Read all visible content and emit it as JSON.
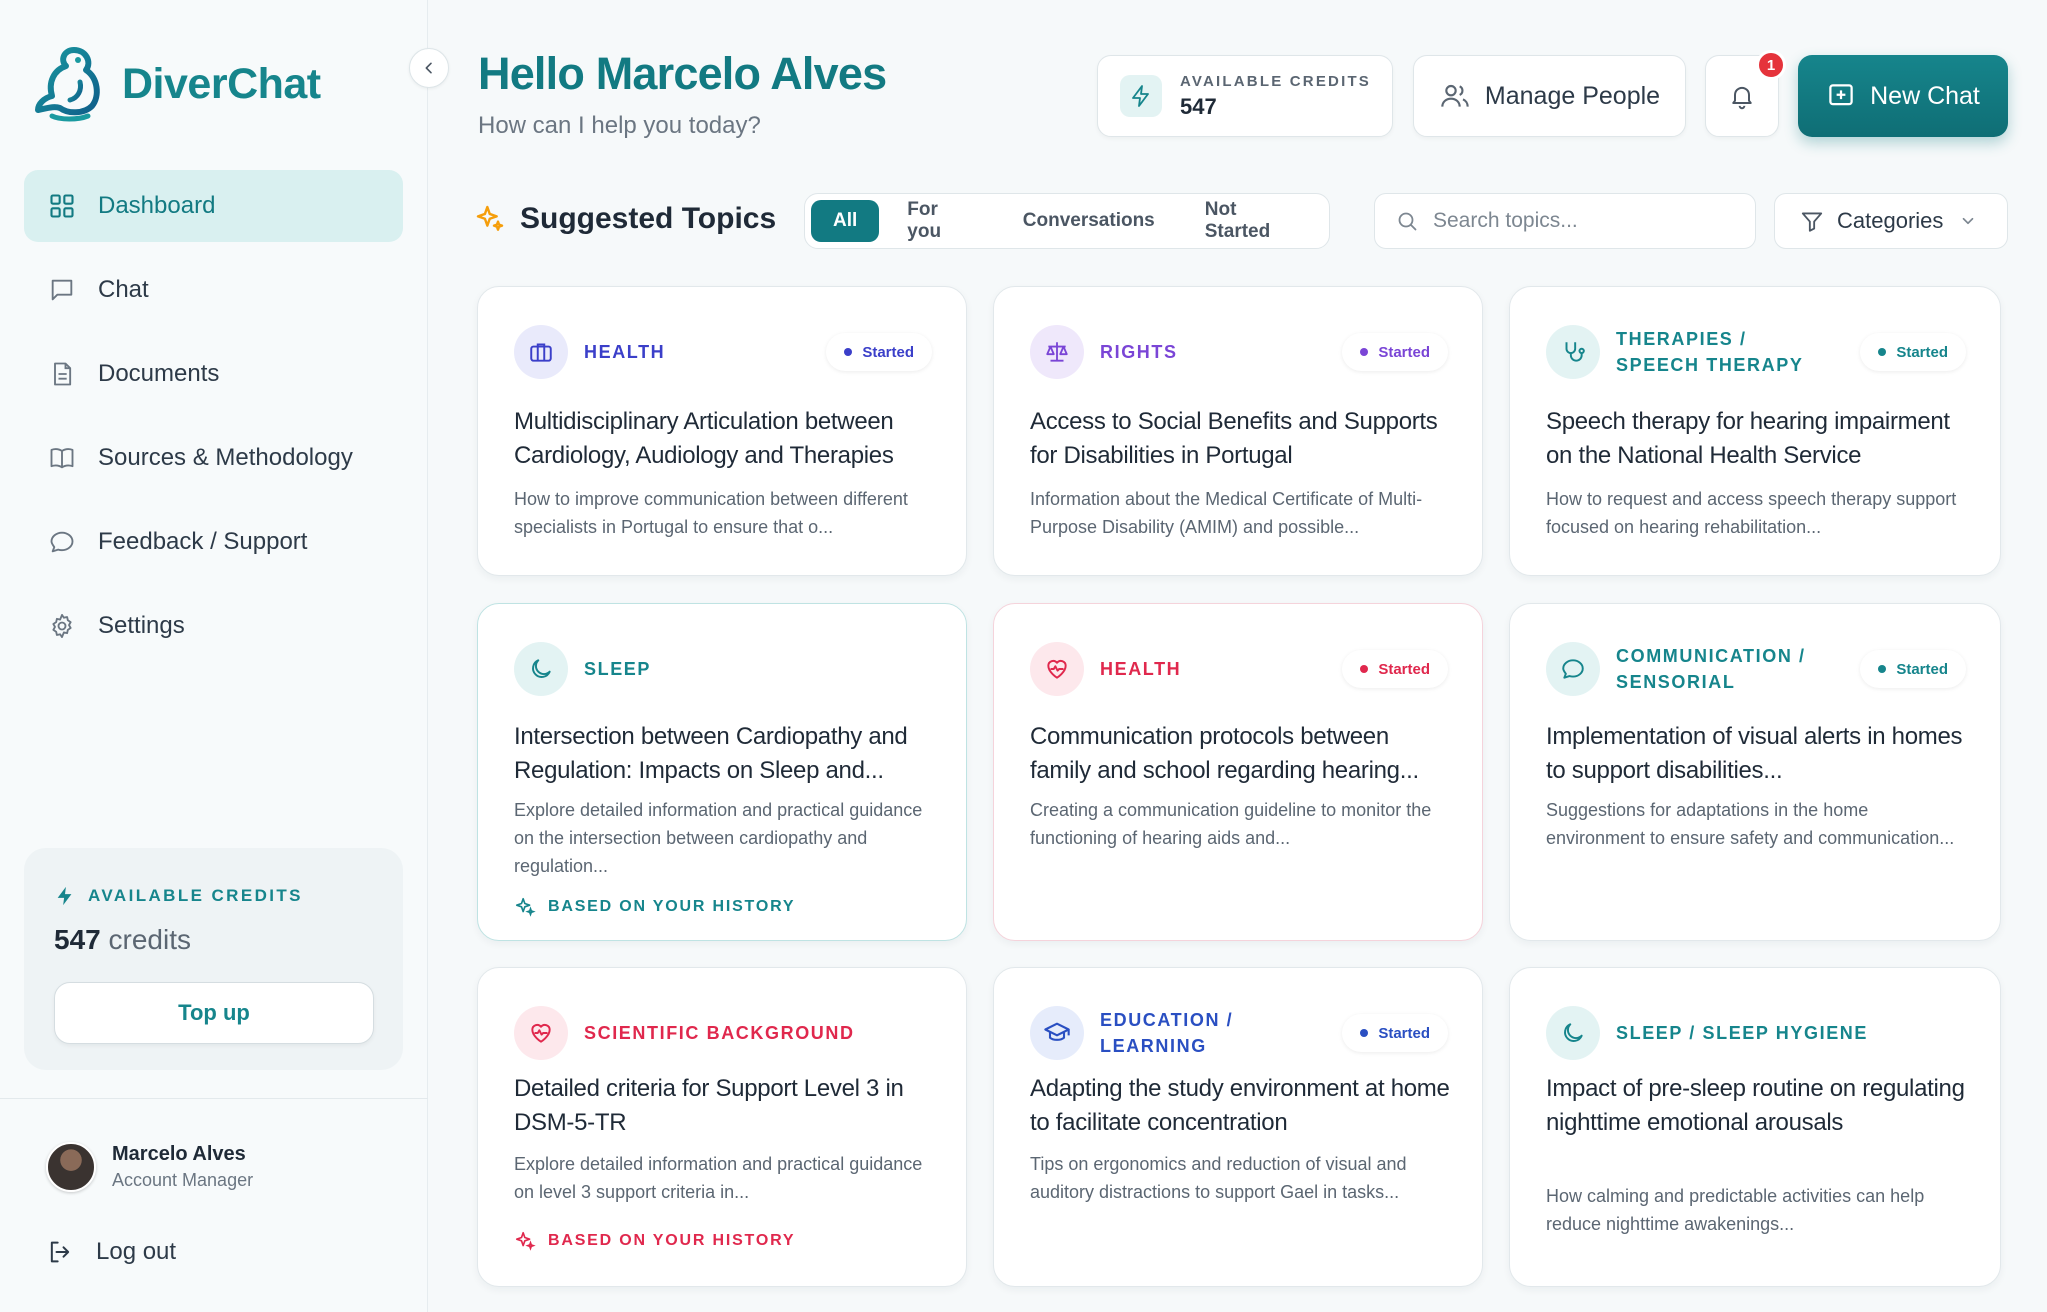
{
  "app": {
    "name": "DiverChat"
  },
  "sidebar": {
    "items": [
      {
        "label": "Dashboard",
        "icon": "dashboard-icon",
        "active": true
      },
      {
        "label": "Chat",
        "icon": "chat-icon"
      },
      {
        "label": "Documents",
        "icon": "document-icon"
      },
      {
        "label": "Sources & Methodology",
        "icon": "book-icon"
      },
      {
        "label": "Feedback / Support",
        "icon": "feedback-icon"
      },
      {
        "label": "Settings",
        "icon": "gear-icon"
      }
    ],
    "credits": {
      "label": "AVAILABLE CREDITS",
      "value": "547",
      "unit": "credits",
      "topup_label": "Top up"
    },
    "user": {
      "name": "Marcelo Alves",
      "role": "Account Manager"
    },
    "logout_label": "Log out"
  },
  "header": {
    "title": "Hello Marcelo Alves",
    "subtitle": "How can I help you today?",
    "credits_label": "AVAILABLE CREDITS",
    "credits_value": "547",
    "manage_people_label": "Manage People",
    "notifications_count": "1",
    "new_chat_label": "New Chat"
  },
  "topics": {
    "title": "Suggested Topics",
    "tabs": [
      "All",
      "For you",
      "Conversations",
      "Not Started"
    ],
    "active_tab": "All",
    "search_placeholder": "Search topics...",
    "categories_label": "Categories",
    "cards": [
      {
        "category": "HEALTH",
        "status": "Started",
        "title": "Multidisciplinary Articulation between Cardiology, Audiology and Therapies",
        "description": "How to improve communication between different specialists in Portugal to ensure that o...",
        "icon": "briefcase-icon",
        "color": "#3b3fc9"
      },
      {
        "category": "RIGHTS",
        "status": "Started",
        "title": "Access to Social Benefits and Supports for Disabilities in Portugal",
        "description": "Information about the Medical Certificate of Multi-Purpose Disability (AMIM) and possible...",
        "icon": "scale-icon",
        "color": "#7a45d6"
      },
      {
        "category": "THERAPIES / SPEECH THERAPY",
        "status": "Started",
        "title": "Speech therapy for hearing impairment on the National Health Service",
        "description": "How to request and access speech therapy support focused on hearing rehabilitation...",
        "icon": "stethoscope-icon",
        "color": "#16858c"
      },
      {
        "category": "SLEEP",
        "status": "",
        "title": "Intersection between Cardiopathy and Regulation: Impacts on Sleep and...",
        "description": "Explore detailed information and practical guidance on the intersection between cardiopathy and regulation...",
        "history": "BASED ON YOUR HISTORY",
        "icon": "moon-icon",
        "color": "#16858c"
      },
      {
        "category": "HEALTH",
        "status": "Started",
        "title": "Communication protocols between family and school regarding hearing...",
        "description": "Creating a communication guideline to monitor the functioning of hearing aids and...",
        "icon": "heart-pulse-icon",
        "color": "#e0284d"
      },
      {
        "category": "COMMUNICATION / SENSORIAL",
        "status": "Started",
        "title": "Implementation of visual alerts in homes to support disabilities...",
        "description": "Suggestions for adaptations in the home environment to ensure safety and communication...",
        "icon": "message-icon",
        "color": "#16858c"
      },
      {
        "category": "SCIENTIFIC BACKGROUND",
        "status": "",
        "title": "Detailed criteria for Support Level 3 in DSM-5-TR",
        "description": "Explore detailed information and practical guidance on level 3 support criteria in...",
        "history": "BASED ON YOUR HISTORY",
        "icon": "heart-pulse-icon",
        "color": "#e0284d"
      },
      {
        "category": "EDUCATION / LEARNING",
        "status": "Started",
        "title": "Adapting the study environment at home to facilitate concentration",
        "description": "Tips on ergonomics and reduction of visual and auditory distractions to support Gael in tasks...",
        "icon": "graduation-cap-icon",
        "color": "#2a4fc2"
      },
      {
        "category": "SLEEP / SLEEP HYGIENE",
        "status": "",
        "title": "Impact of pre-sleep routine on regulating nighttime emotional arousals",
        "description": "How calming and predictable activities can help reduce nighttime awakenings...",
        "icon": "moon-icon",
        "color": "#16858c"
      }
    ]
  }
}
